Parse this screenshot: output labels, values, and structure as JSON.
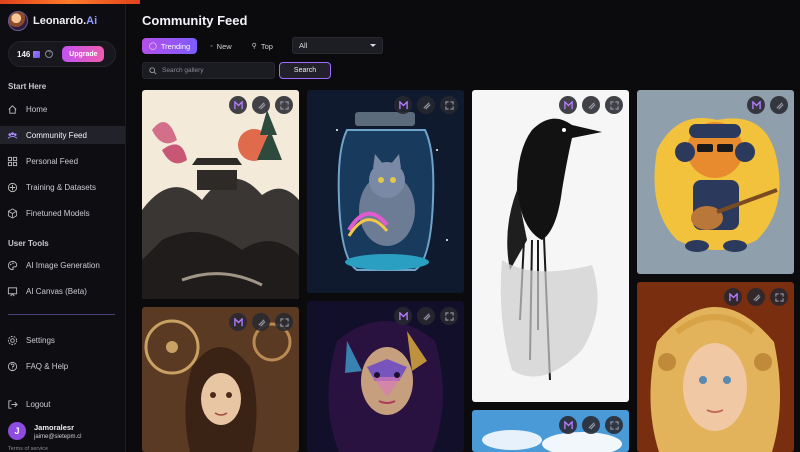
{
  "brand": {
    "name": "Leonardo.",
    "suffix": "Ai"
  },
  "tokens": {
    "count": "146",
    "upgrade_label": "Upgrade"
  },
  "sidebar": {
    "start_here_label": "Start Here",
    "start_items": [
      {
        "label": "Home",
        "icon": "home-icon"
      },
      {
        "label": "Community Feed",
        "icon": "community-icon"
      },
      {
        "label": "Personal Feed",
        "icon": "grid-icon"
      },
      {
        "label": "Training & Datasets",
        "icon": "training-icon"
      },
      {
        "label": "Finetuned Models",
        "icon": "cube-icon"
      }
    ],
    "user_tools_label": "User Tools",
    "tool_items": [
      {
        "label": "AI Image Generation",
        "icon": "palette-icon"
      },
      {
        "label": "AI Canvas (Beta)",
        "icon": "canvas-icon"
      }
    ],
    "bottom_items": [
      {
        "label": "Settings",
        "icon": "gear-icon"
      },
      {
        "label": "FAQ & Help",
        "icon": "help-icon"
      },
      {
        "label": "Logout",
        "icon": "logout-icon"
      }
    ]
  },
  "user": {
    "initial": "J",
    "name": "Jamoralesr",
    "email": "jaime@sietepm.cl",
    "terms": "Terms of service"
  },
  "main": {
    "title": "Community Feed",
    "tabs": [
      {
        "label": "Trending",
        "icon": "fire-icon"
      },
      {
        "label": "New",
        "icon": "dot-icon"
      },
      {
        "label": "Top",
        "icon": "trophy-icon"
      }
    ],
    "filter_selected": "All",
    "search_placeholder": "Search gallery",
    "search_button": "Search"
  },
  "gallery": {
    "images": [
      "pagoda-landscape-image",
      "cat-in-jar-image",
      "raven-image",
      "tiger-guitar-image",
      "steampunk-girl-image",
      "cosmic-woman-image",
      "sky-clouds-image",
      "golden-woman-image"
    ]
  },
  "colors": {
    "accent": "#b54fe9",
    "accent2": "#7d5cff",
    "upgrade": "#ef5db0",
    "background": "#0b0b0e"
  }
}
